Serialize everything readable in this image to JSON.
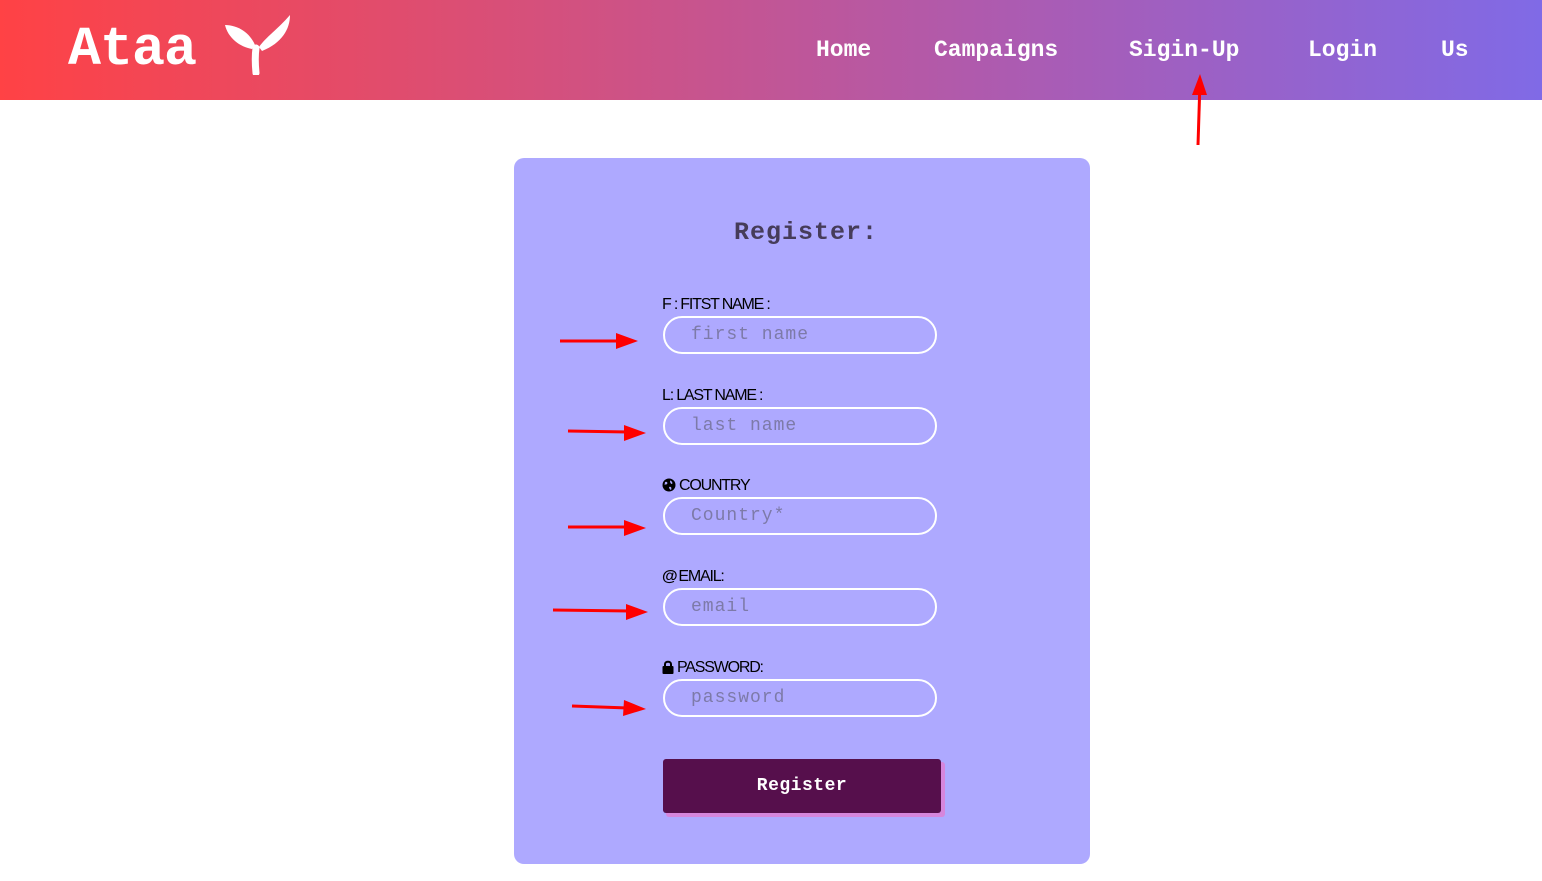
{
  "header": {
    "logo_text": "Ataa",
    "nav": [
      "Home",
      "Campaigns",
      "Sigin-Up",
      "Login",
      "Us"
    ]
  },
  "form": {
    "title": "Register:",
    "fields": [
      {
        "label": "F : FITST NAME :",
        "placeholder": "first name"
      },
      {
        "label": "L: LAST NAME :",
        "placeholder": "last name"
      },
      {
        "label": "COUNTRY",
        "placeholder": "Country*",
        "icon": "globe-icon"
      },
      {
        "label": "EMAIL:",
        "placeholder": "email",
        "icon": "at-icon"
      },
      {
        "label": "PASSWORD:",
        "placeholder": "password",
        "icon": "lock-icon"
      }
    ],
    "submit_label": "Register"
  },
  "colors": {
    "header_gradient": [
      "#ff4245",
      "#d5507c",
      "#a95cb5",
      "#806ae6"
    ],
    "card_bg": "#aea9ff",
    "button_bg": "#560f4c",
    "button_shadow": "#d686dc",
    "annotation_arrow": "#ff0000"
  }
}
